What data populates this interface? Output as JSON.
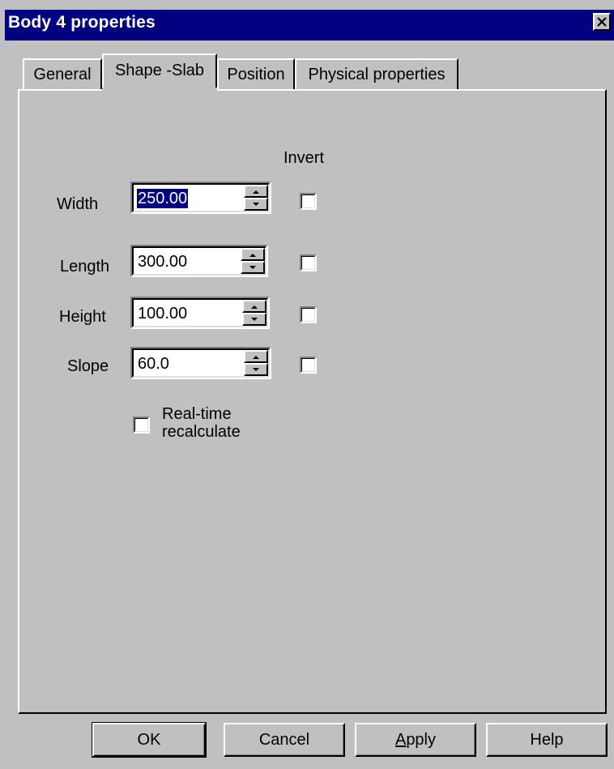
{
  "window": {
    "title": "Body 4 properties",
    "close_icon": "close-icon",
    "titlebar_color": "#000080"
  },
  "tabs": [
    {
      "label": "General",
      "active": false
    },
    {
      "label": "Shape -Slab",
      "active": true
    },
    {
      "label": "Position",
      "active": false
    },
    {
      "label": "Physical properties",
      "active": false
    }
  ],
  "form": {
    "invert_header": "Invert",
    "fields": [
      {
        "label": "Width",
        "value": "250.00",
        "selected": true,
        "invert": false
      },
      {
        "label": "Length",
        "value": "300.00",
        "selected": false,
        "invert": false
      },
      {
        "label": "Height",
        "value": "100.00",
        "selected": false,
        "invert": false
      },
      {
        "label": "Slope",
        "value": "60.0",
        "selected": false,
        "invert": false
      }
    ],
    "realtime": {
      "line1": "Real-time",
      "line2": "recalculate",
      "checked": false
    }
  },
  "buttons": {
    "ok": "OK",
    "cancel": "Cancel",
    "apply_first": "A",
    "apply_rest": "pply",
    "help": "Help"
  }
}
